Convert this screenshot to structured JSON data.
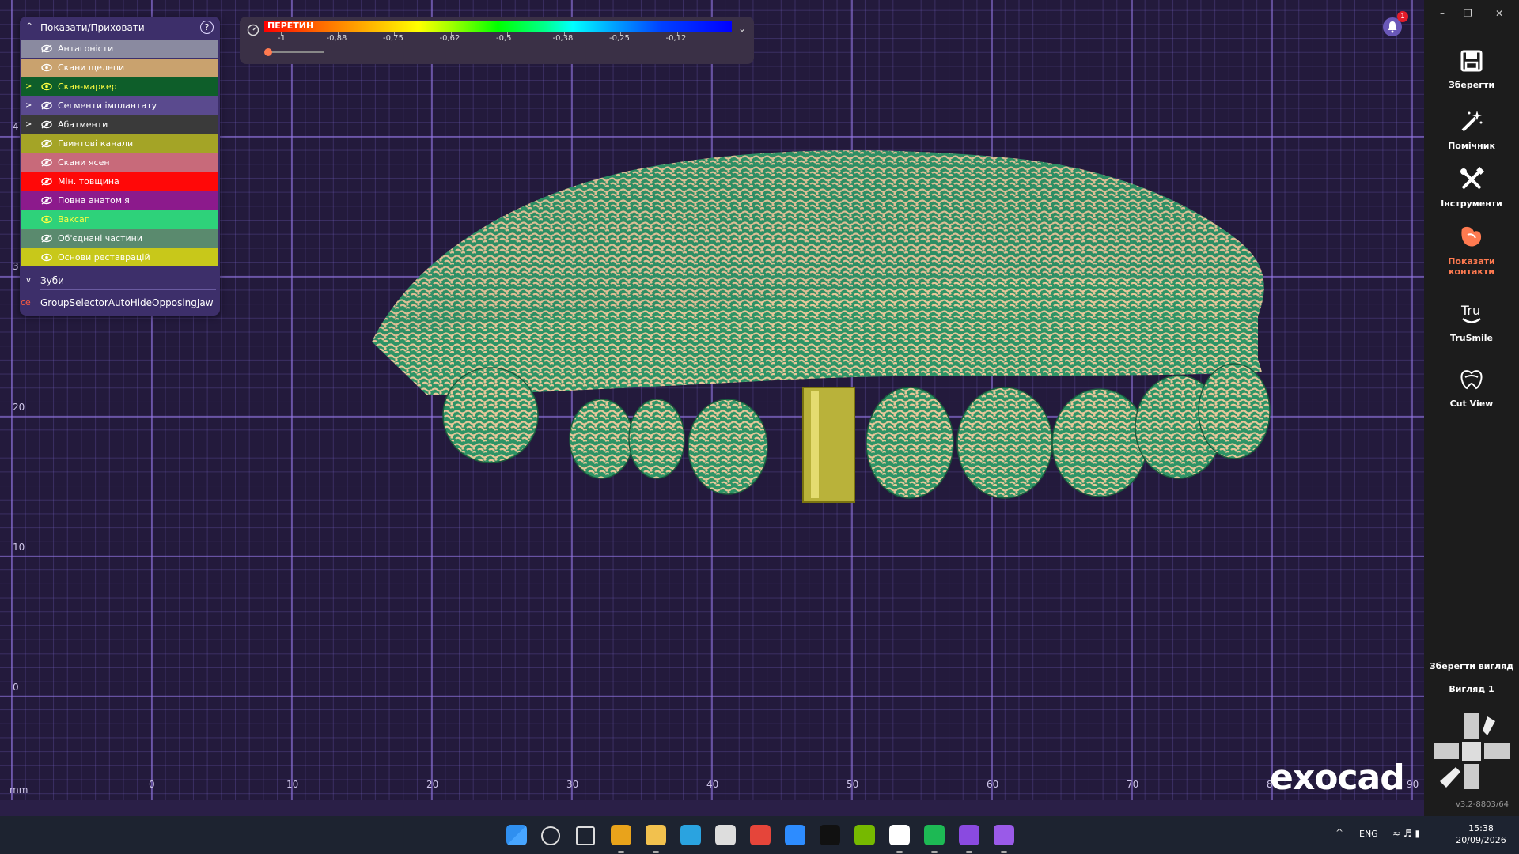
{
  "show_hide": {
    "title": "Показати/Приховати",
    "help": "?",
    "layers": [
      {
        "label": "Антагоністи",
        "bg": "#8a8aa0",
        "fg": "#ffffff",
        "expand": false,
        "visible": false
      },
      {
        "label": "Скани щелепи",
        "bg": "#c9a26e",
        "fg": "#ffffff",
        "expand": false,
        "visible": true
      },
      {
        "label": "Скан-маркер",
        "bg": "#0e5e2a",
        "fg": "#ffff40",
        "expand": true,
        "visible": true
      },
      {
        "label": "Сегменти імплантату",
        "bg": "#5a4a8e",
        "fg": "#ffffff",
        "expand": true,
        "visible": false
      },
      {
        "label": "Абатменти",
        "bg": "#3a3a3a",
        "fg": "#ffffff",
        "expand": true,
        "visible": false
      },
      {
        "label": "Гвинтові канали",
        "bg": "#a4a426",
        "fg": "#ffffff",
        "expand": false,
        "visible": false
      },
      {
        "label": "Скани ясен",
        "bg": "#c86a7a",
        "fg": "#ffffff",
        "expand": false,
        "visible": false
      },
      {
        "label": "Мін. товщина",
        "bg": "#ff0808",
        "fg": "#ffffff",
        "expand": false,
        "visible": false
      },
      {
        "label": "Повна анатомія",
        "bg": "#8c1a8c",
        "fg": "#ffffff",
        "expand": false,
        "visible": false
      },
      {
        "label": "Ваксап",
        "bg": "#2ed27a",
        "fg": "#ffff40",
        "expand": false,
        "visible": true
      },
      {
        "label": "Об'єднані частини",
        "bg": "#5a8a6e",
        "fg": "#ffffff",
        "expand": false,
        "visible": false
      },
      {
        "label": "Основи реставрацій",
        "bg": "#c8c81a",
        "fg": "#ffffff",
        "expand": false,
        "visible": true
      }
    ],
    "teeth_label": "Зуби",
    "debug_prefix": "ce",
    "debug_text": "GroupSelectorAutoHideOpposingJaw"
  },
  "scale": {
    "label": "ПЕРЕТИН",
    "ticks": [
      "-1",
      "-0,88",
      "-0,75",
      "-0,62",
      "-0,5",
      "-0,38",
      "-0,25",
      "-0,12"
    ]
  },
  "axis": {
    "unit": "mm",
    "x_labels": [
      "0",
      "10",
      "20",
      "30",
      "40",
      "50",
      "60",
      "70",
      "80",
      "90"
    ],
    "y_labels": [
      "4",
      "3",
      "20",
      "10",
      "0"
    ]
  },
  "notification": {
    "count": "1"
  },
  "right_panel": {
    "buttons": [
      {
        "label": "Зберегти",
        "icon": "save-icon"
      },
      {
        "label": "Помічник",
        "icon": "wizard-wand-icon"
      },
      {
        "label": "Інструменти",
        "icon": "tools-icon"
      },
      {
        "label": "Показати контакти",
        "icon": "show-contacts-icon",
        "accent": "#ff7a50"
      },
      {
        "label": "TruSmile",
        "icon": "trusmile-icon"
      },
      {
        "label": "Cut View",
        "icon": "cut-view-icon"
      }
    ],
    "save_view": "Зберегти вигляд",
    "view1": "Вигляд 1",
    "logo": "exocad",
    "version": "v3.2-8803/64"
  },
  "taskbar": {
    "apps": [
      "windows-start-icon",
      "search-icon",
      "task-view-icon",
      "chrome-icon",
      "file-explorer-icon",
      "telegram-icon",
      "notion-icon",
      "anydesk-icon",
      "zoom-icon",
      "tiktok-icon",
      "nvidia-icon",
      "chatgpt-icon",
      "spotify-icon",
      "exocad-app-icon",
      "cad-app-icon"
    ],
    "lang": "ENG",
    "time": "15:38",
    "date": "20/09/2026"
  }
}
